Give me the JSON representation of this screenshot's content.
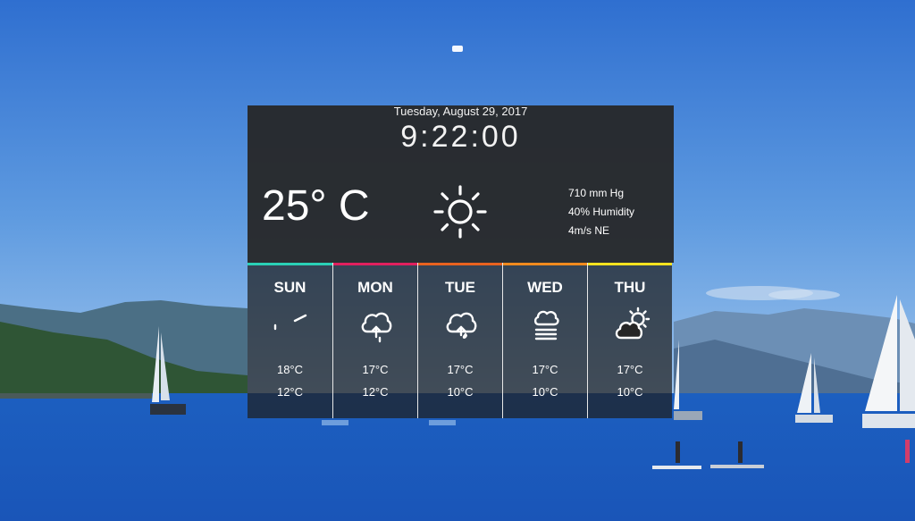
{
  "colors": {
    "widget_bg": "#262626",
    "sun_bar": "#2ad0b6",
    "mon_bar": "#e0205e",
    "tue_bar": "#e8621f",
    "wed_bar": "#f08a1e",
    "thu_bar": "#f5e21f"
  },
  "clock": {
    "date": "Tuesday, August 29, 2017",
    "time": "9:22:00"
  },
  "current": {
    "temperature": "25° C",
    "icon": "sun-icon",
    "pressure": "710 mm Hg",
    "humidity": "40% Humidity",
    "wind": "4m/s NE"
  },
  "forecast": [
    {
      "day": "SUN",
      "icon": "wind-icon",
      "high": "18°C",
      "low": "12°C",
      "accent": "#2ad0b6"
    },
    {
      "day": "MON",
      "icon": "cloud-rain-icon",
      "high": "17°C",
      "low": "12°C",
      "accent": "#e0205e"
    },
    {
      "day": "TUE",
      "icon": "cloud-drizzle-icon",
      "high": "17°C",
      "low": "10°C",
      "accent": "#e8621f"
    },
    {
      "day": "WED",
      "icon": "cloud-fog-icon",
      "high": "17°C",
      "low": "10°C",
      "accent": "#f08a1e"
    },
    {
      "day": "THU",
      "icon": "partly-cloudy-icon",
      "high": "17°C",
      "low": "10°C",
      "accent": "#f5e21f"
    }
  ]
}
